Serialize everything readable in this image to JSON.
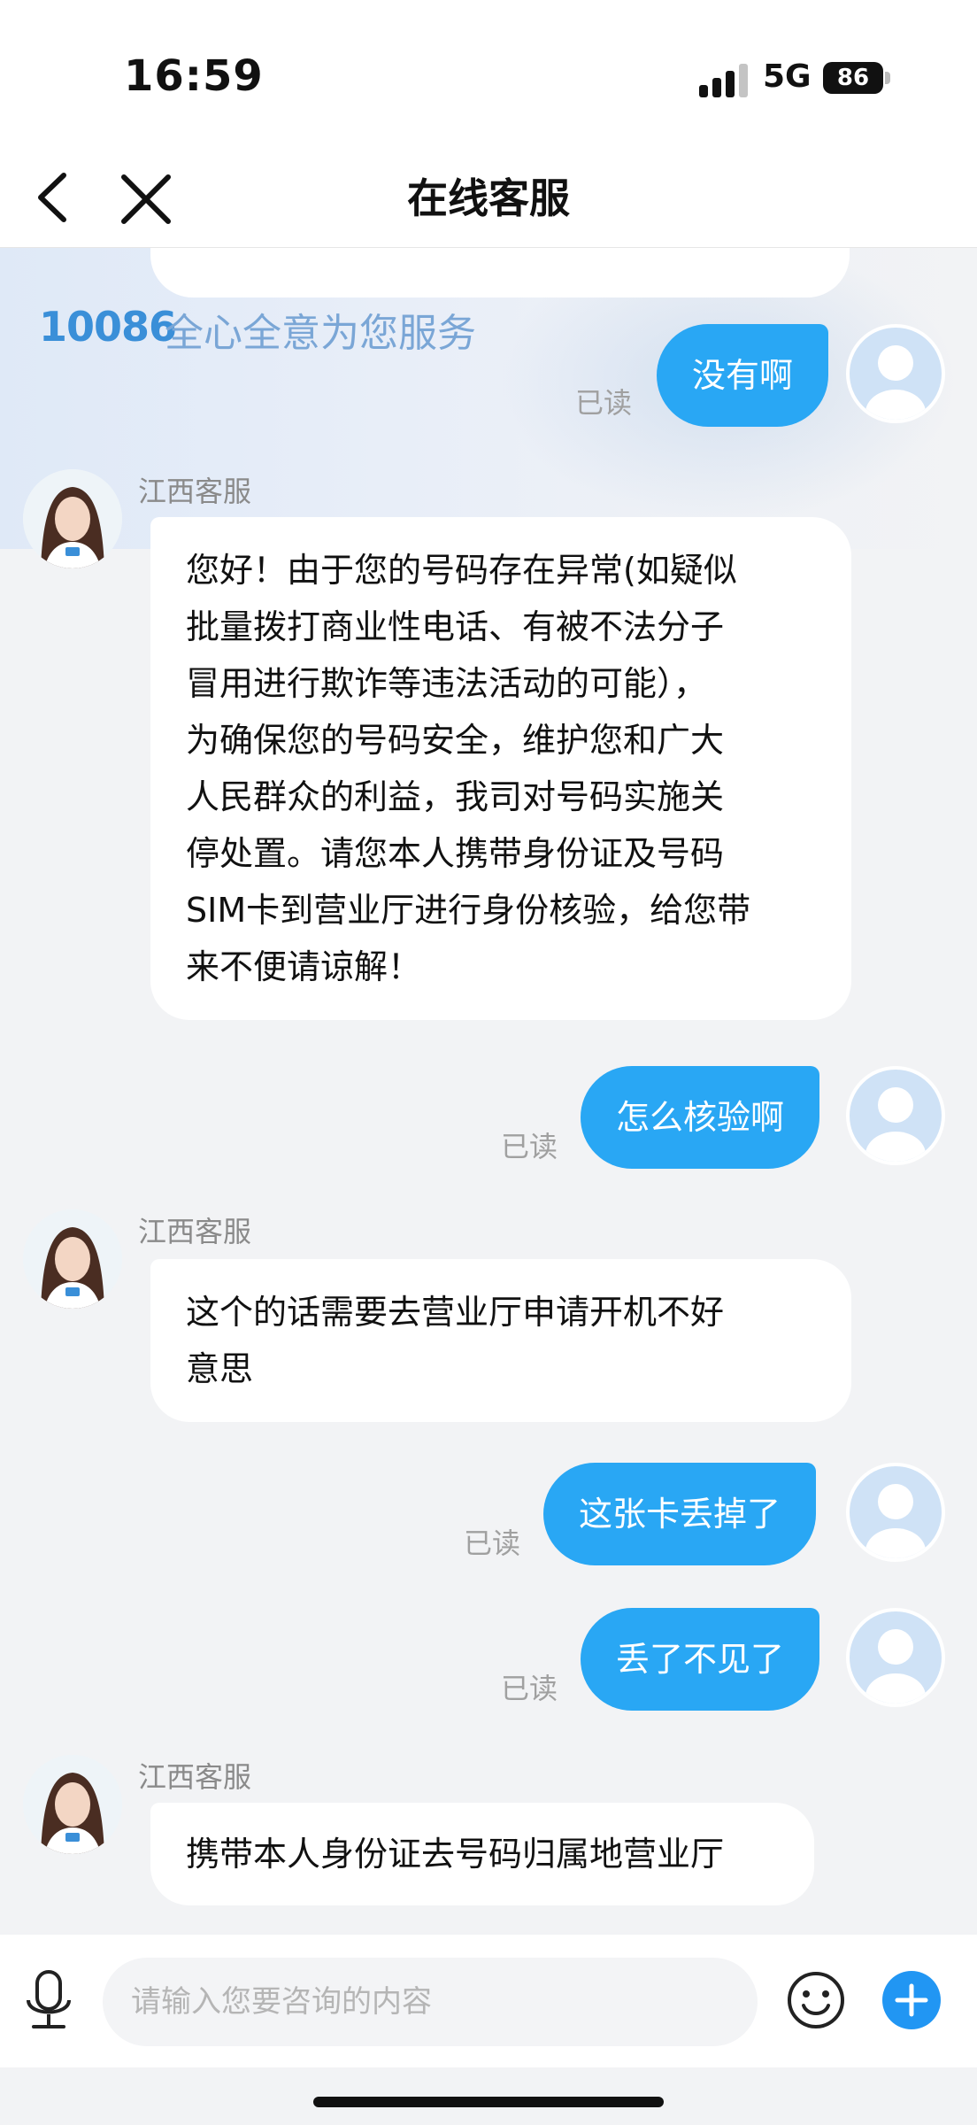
{
  "status_bar": {
    "time": "16:59",
    "network": "5G",
    "battery": "86"
  },
  "nav": {
    "title": "在线客服"
  },
  "banner": {
    "logo_text": "10086",
    "slogan": "全心全意为您服务"
  },
  "agent_name": "江西客服",
  "read_label": "已读",
  "messages": [
    {
      "from": "user",
      "text": "没有啊"
    },
    {
      "from": "agent",
      "name": "江西客服",
      "lines": [
        "您好！由于您的号码存在异常(如疑似",
        "批量拨打商业性电话、有被不法分子",
        "冒用进行欺诈等违法活动的可能），",
        "为确保您的号码安全，维护您和广大",
        "人民群众的利益，我司对号码实施关",
        "停处置。请您本人携带身份证及号码",
        "SIM卡到营业厅进行身份核验，给您带",
        "来不便请谅解！"
      ]
    },
    {
      "from": "user",
      "text": "怎么核验啊"
    },
    {
      "from": "agent",
      "name": "江西客服",
      "lines": [
        "这个的话需要去营业厅申请开机不好",
        "意思"
      ]
    },
    {
      "from": "user",
      "text": "这张卡丢掉了"
    },
    {
      "from": "user",
      "text": "丢了不见了"
    },
    {
      "from": "agent",
      "name": "江西客服",
      "lines": [
        "携带本人身份证去号码归属地营业厅"
      ]
    }
  ],
  "input": {
    "placeholder": "请输入您要咨询的内容"
  },
  "icons": {
    "back": "chevron-left-icon",
    "close": "close-icon",
    "mic": "microphone-icon",
    "emoji": "smiley-icon",
    "plus": "plus-icon"
  },
  "colors": {
    "user_bubble": "#29a7f4",
    "plus_button": "#2196f3",
    "background": "#f2f3f5"
  }
}
